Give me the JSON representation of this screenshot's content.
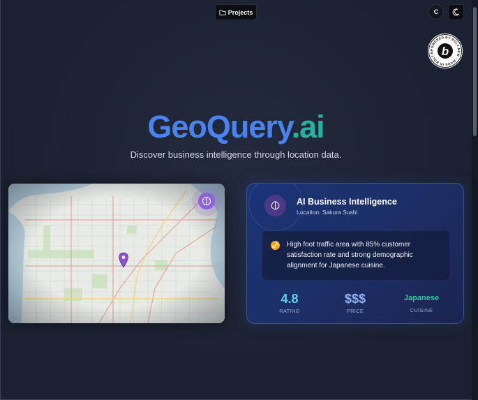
{
  "toolbar": {
    "projects_label": "Projects",
    "avatar_initial": "C"
  },
  "badge": {
    "ring_text": "POWERED BY BOLT.NEW · MADE IN BOLT.NEW ·",
    "letter": "b"
  },
  "hero": {
    "title_part1": "GeoQuery",
    "title_part2": ".ai",
    "subtitle": "Discover business intelligence through location data."
  },
  "ai_card": {
    "title": "AI Business Intelligence",
    "location": "Location: Sakura Sushi",
    "insight": "High foot traffic area with 85% customer satisfaction rate and strong demographic alignment for Japanese cuisine.",
    "stats": [
      {
        "value": "4.8",
        "label": "RATING"
      },
      {
        "value": "$$$",
        "label": "PRICE"
      },
      {
        "value": "Japanese",
        "label": "CUISINE"
      }
    ]
  },
  "colors": {
    "accent_blue": "#4a82ee",
    "accent_teal": "#20b5a0",
    "purple": "#8e62d8",
    "card_bg": "#1a3478",
    "page_bg": "#1c2232"
  },
  "icons": {
    "projects": "folder-icon",
    "theme": "moon-icon",
    "map_toggle": "brain-icon",
    "map_marker": "map-pin-icon",
    "ai": "brain-icon",
    "insight": "link-icon"
  }
}
